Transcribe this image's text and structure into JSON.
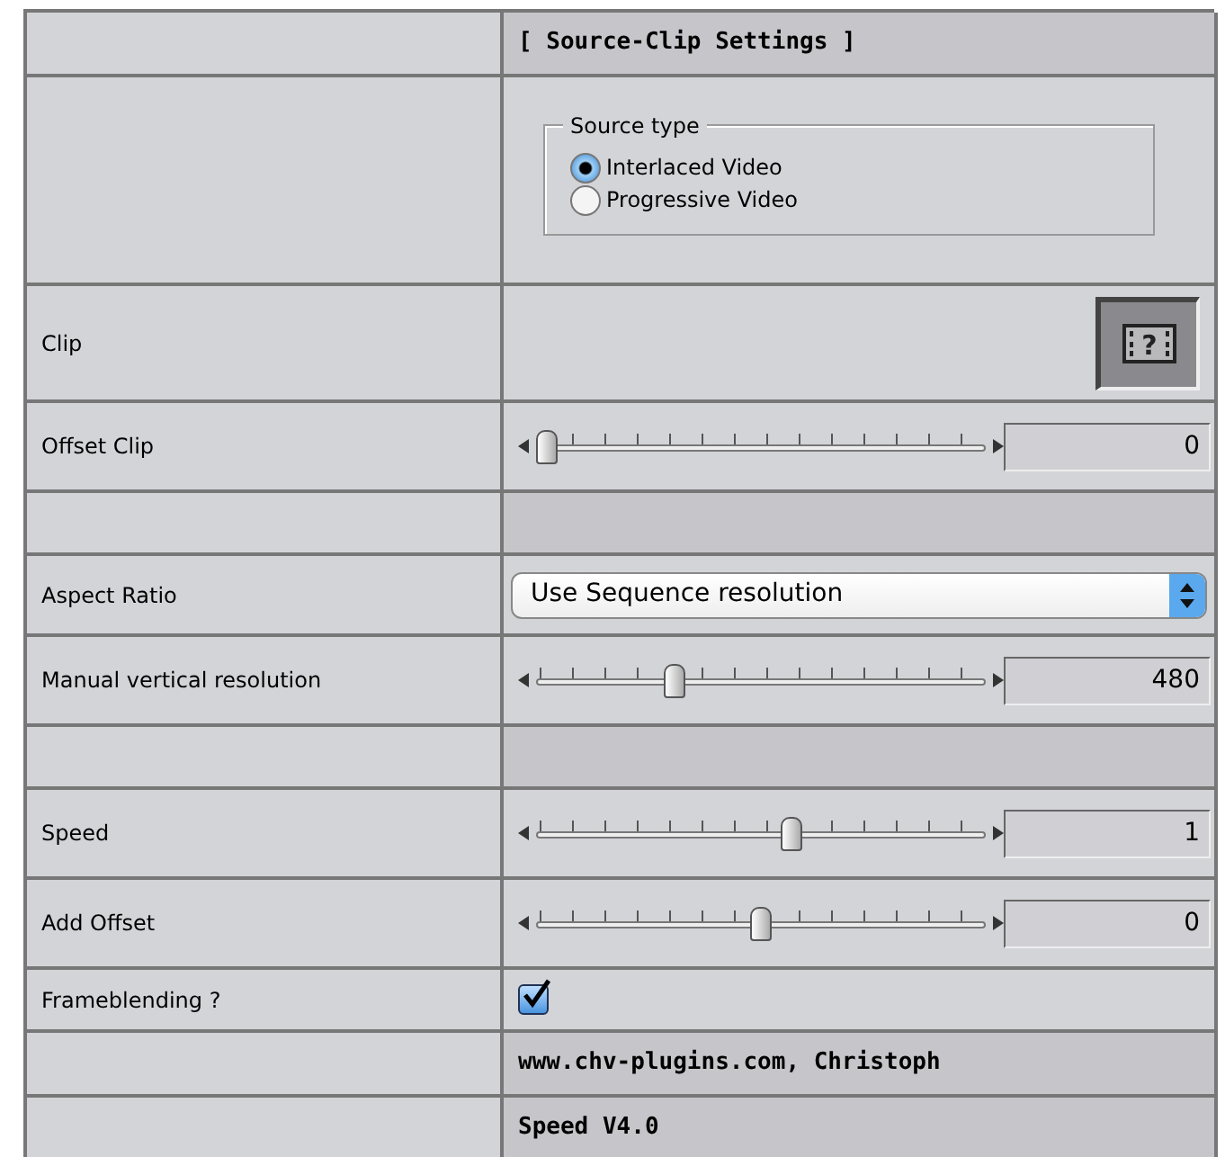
{
  "rows": [
    {
      "kind": "header",
      "label": "",
      "text": "[ Source-Clip Settings ]"
    },
    {
      "kind": "radio_group",
      "label": "",
      "legend": "Source type",
      "options": [
        {
          "label": "Interlaced Video",
          "selected": true
        },
        {
          "label": "Progressive Video",
          "selected": false
        }
      ]
    },
    {
      "kind": "clip_button",
      "label": "Clip",
      "icon_glyph": "?"
    },
    {
      "kind": "slider",
      "label": "Offset Clip",
      "level": 0.0,
      "value": "0"
    },
    {
      "kind": "spacer",
      "label": ""
    },
    {
      "kind": "dropdown",
      "label": "Aspect Ratio",
      "value": "Use Sequence resolution"
    },
    {
      "kind": "slider",
      "label": "Manual vertical resolution",
      "level": 0.3,
      "value": "480"
    },
    {
      "kind": "spacer",
      "label": ""
    },
    {
      "kind": "slider",
      "label": "Speed",
      "level": 0.57,
      "value": "1"
    },
    {
      "kind": "slider",
      "label": "Add Offset",
      "level": 0.5,
      "value": "0"
    },
    {
      "kind": "checkbox",
      "label": "Frameblending ?",
      "checked": true
    },
    {
      "kind": "bold_text",
      "label": "",
      "text": "www.chv-plugins.com, Christoph"
    },
    {
      "kind": "bold_text",
      "label": "",
      "text": "Speed V4.0"
    }
  ]
}
